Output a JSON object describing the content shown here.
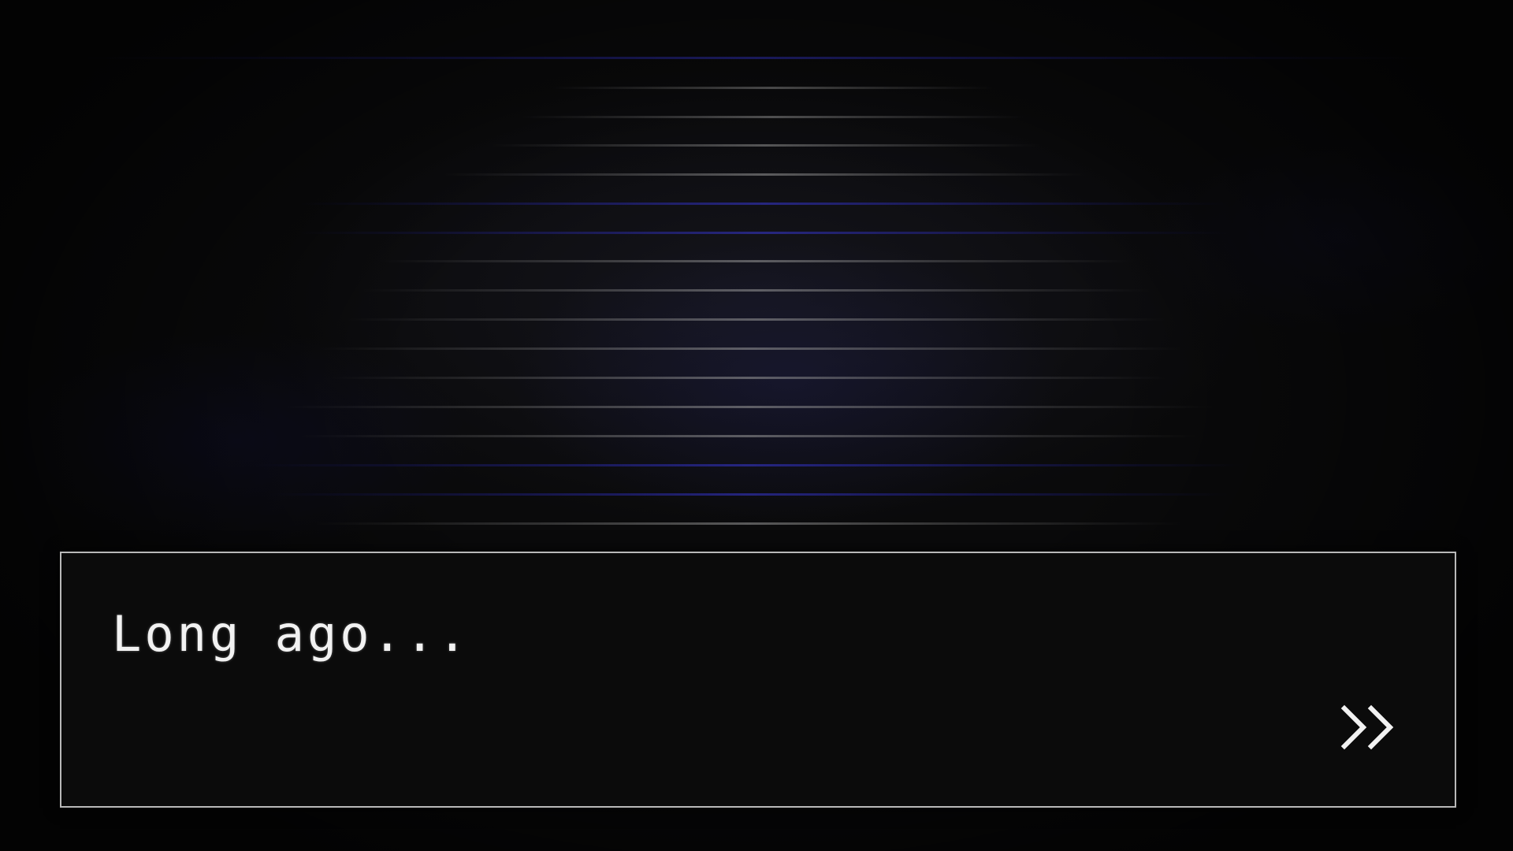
{
  "dialog": {
    "text": "Long ago...",
    "advance_icon": "double-chevron-right-icon"
  },
  "colors": {
    "background": "#0a0a0b",
    "dialog_background": "#0b0b0b",
    "dialog_border": "#b9b9b9",
    "text": "#f2f2f2"
  }
}
